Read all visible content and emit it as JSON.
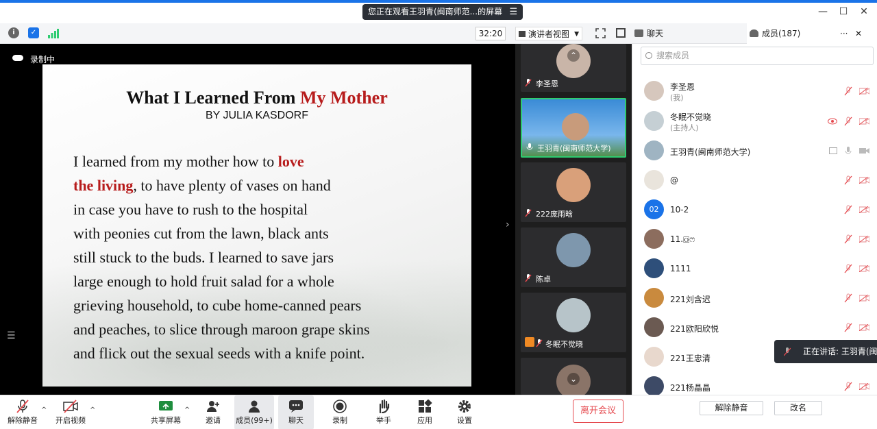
{
  "window": {
    "share_banner": "您正在观看王羽青(闽南师范...的屏幕",
    "minimize": "—",
    "maximize": "☐",
    "close": "✕"
  },
  "toolbar": {
    "timer": "32:20",
    "view_mode": "演讲者视图"
  },
  "tabs": {
    "chat": "聊天",
    "members": "成员(187)",
    "more": "···",
    "close": "✕"
  },
  "video": {
    "recording": "录制中",
    "slide": {
      "title_black": "What I Learned From ",
      "title_red": "My Mother",
      "author": "BY JULIA KASDORF",
      "line1_a": "I learned from my mother how to ",
      "line1_red": "love",
      "line2_red": "the living",
      "line2_b": ", to have plenty of vases on hand",
      "lines": [
        "in case you have to rush to the hospital",
        "with peonies cut from the lawn, black ants",
        "still stuck to the buds. I learned to save jars",
        "large enough to hold fruit salad for a whole",
        "grieving household, to cube home-canned pears",
        "and peaches, to slice through maroon grape skins",
        "and flick out the sexual seeds with a knife point."
      ]
    }
  },
  "thumbnails": [
    {
      "name": "李圣恩"
    },
    {
      "name": "王羽青(闽南师范大学)"
    },
    {
      "name": "222庞雨晗"
    },
    {
      "name": "陈卓"
    },
    {
      "name": "冬眠不觉晓"
    }
  ],
  "members": {
    "search_placeholder": "搜索成员",
    "list": [
      {
        "name": "李圣恩",
        "role": "(我)"
      },
      {
        "name": "冬眠不觉晓",
        "role": "(主持人)"
      },
      {
        "name": "王羽青(闽南师范大学)",
        "role": ""
      },
      {
        "name": "@",
        "role": ""
      },
      {
        "name": "10-2",
        "role": "",
        "avatar_text": "02"
      },
      {
        "name": "11.🄾ෆ",
        "role": ""
      },
      {
        "name": "1111",
        "role": ""
      },
      {
        "name": "221刘含迟",
        "role": ""
      },
      {
        "name": "221欧阳欣悦",
        "role": ""
      },
      {
        "name": "221王忠清",
        "role": ""
      },
      {
        "name": "221杨晶晶",
        "role": ""
      }
    ],
    "speaking": "正在讲话: 王羽青(闽南"
  },
  "bottom": {
    "unmute": "解除静音",
    "start_video": "开启视频",
    "share_screen": "共享屏幕",
    "invite": "邀请",
    "members": "成员(99+)",
    "chat": "聊天",
    "record": "录制",
    "raise_hand": "举手",
    "apps": "应用",
    "settings": "设置",
    "leave": "离开会议",
    "panel_unmute": "解除静音",
    "rename": "改名"
  },
  "colors": {
    "accent": "#1a73e8",
    "red_text": "#b71c1c",
    "leave": "#e5484d",
    "active_border": "#2ecc71"
  }
}
